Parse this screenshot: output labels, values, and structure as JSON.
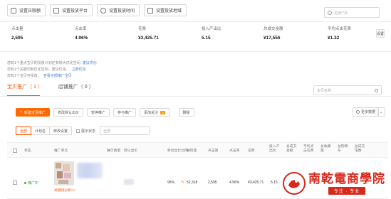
{
  "toolbar": {
    "items": [
      "设置日限额",
      "设置投放平台",
      "设置投放时间",
      "设置投放地域"
    ]
  },
  "date_search": {
    "placeholder": "过去7天"
  },
  "metrics": [
    {
      "label": "点击量",
      "value": "2,595"
    },
    {
      "label": "点击率",
      "value": "4.96%"
    },
    {
      "label": "花费",
      "value": "¥3,425.71"
    },
    {
      "label": "投入产出比",
      "value": "5.15"
    },
    {
      "label": "总成交金额",
      "value": "¥17,556"
    },
    {
      "label": "平均点击花费",
      "value": "¥1.32"
    }
  ],
  "settings_label": "设置",
  "notices": [
    {
      "text": "您有1个重点宝贝的投放计划还有较大优化空间",
      "link": "建议优化"
    },
    {
      "text": "您有1个关键词有优化空间，建议优化。",
      "link": "立即优化"
    },
    {
      "text": "您有1个宝贝可投放，",
      "link": "查看全部推广宝贝"
    }
  ],
  "tabs": [
    {
      "label": "宝贝推广（ 1 ）",
      "active": true
    },
    {
      "label": "店铺推广（ 0 ）",
      "active": false
    }
  ],
  "name_search": {
    "placeholder": "宝贝名称"
  },
  "actions": {
    "new_promo": "新建宝贝推广",
    "edit_default_bid": "修改默认出价",
    "pause": "暂停推广",
    "join": "参与推广",
    "add_follow": "添加关注",
    "add_follow_badge": "0",
    "delete": "删除",
    "more_data": "更多数据"
  },
  "filters": {
    "all": "全部",
    "plan": "计划名",
    "modify": "修改设置",
    "display_status": "展示状态",
    "select_placeholder": "全部"
  },
  "table": {
    "headers": [
      "状态",
      "推广单元",
      "展示质量",
      "默认出价",
      "移动出价比例",
      "展现量",
      "点击量",
      "点击率",
      "花费",
      "投入产出比",
      "总成交金额",
      "平均点击花费",
      "总收藏量",
      "总购物车",
      "总成交笔数"
    ],
    "rows": [
      {
        "status": "推广中",
        "key_link": "关键词分析>>",
        "mobile_ratio": "95%",
        "impressions": "52,318",
        "clicks": "2,595",
        "ctr": "4.96%",
        "cost": "¥3,425.71",
        "roi": "5.15"
      }
    ]
  },
  "watermark": {
    "title": "南乾電商學院",
    "subtitle": "专注 · 专业"
  },
  "colors": {
    "accent": "#ff5000",
    "button_primary": "#ff6a00",
    "link": "#4a7bd0",
    "status_active": "#39a845",
    "watermark_red": "#d8281c"
  }
}
